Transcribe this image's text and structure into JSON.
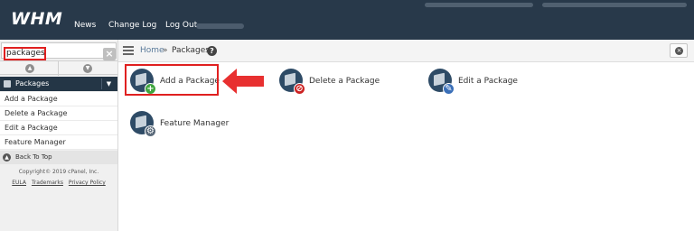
{
  "topbar": {
    "logo": "WHM",
    "nav": [
      "News",
      "Change Log",
      "Log Out"
    ]
  },
  "sidebar": {
    "search": {
      "value": "packages",
      "clear_icon": "close-icon"
    },
    "category": {
      "label": "Packages",
      "icon": "package-icon"
    },
    "items": [
      "Add a Package",
      "Delete a Package",
      "Edit a Package",
      "Feature Manager"
    ],
    "back_to_top": "Back To Top",
    "copyright": "Copyright© 2019 cPanel, Inc.",
    "footer_links": [
      "EULA",
      "Trademarks",
      "Privacy Policy"
    ]
  },
  "breadcrumb": {
    "home": "Home",
    "separator": "»",
    "page": "Packages",
    "help": "?"
  },
  "apps": [
    {
      "label": "Add a Package",
      "badge": "+",
      "badge_color": "#3fa53f"
    },
    {
      "label": "Delete a Package",
      "badge": "⊘",
      "badge_color": "#cc2222"
    },
    {
      "label": "Edit a Package",
      "badge": "✎",
      "badge_color": "#3a6fb8"
    },
    {
      "label": "Feature Manager",
      "badge": "⚙",
      "badge_color": "#5a6a7a"
    }
  ],
  "colors": {
    "topbar": "#28394a",
    "highlight": "#e02020"
  }
}
